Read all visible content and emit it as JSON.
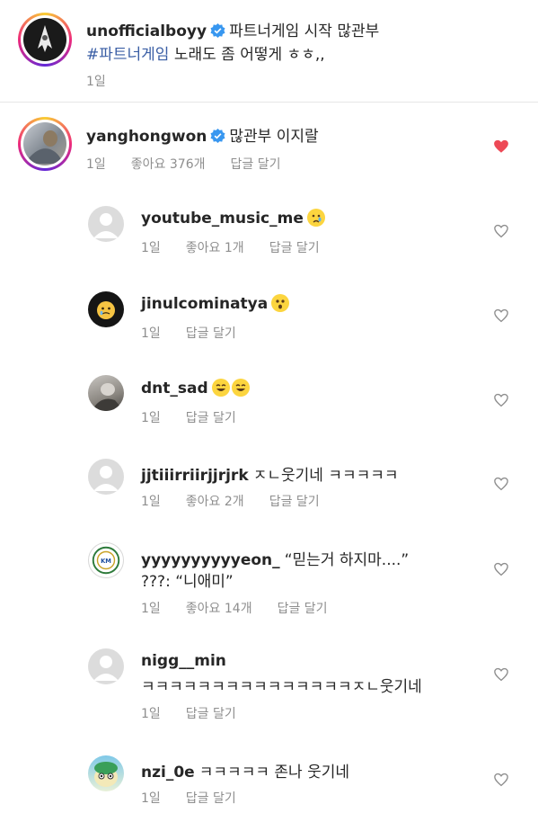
{
  "post": {
    "username": "unofficialboyy",
    "caption_line1": "파트너게임 시작 많관부",
    "hashtag": "#파트너게임",
    "caption_line2_rest": " 노래도 좀 어떻게 ㅎㅎ,,",
    "time": "1일"
  },
  "comment": {
    "username": "yanghongwon",
    "text": "많관부 이지랄",
    "time": "1일",
    "likes": "좋아요 376개",
    "reply": "답글 달기"
  },
  "replies": [
    {
      "username": "youtube_music_me",
      "text": "",
      "emoji": "crying-face",
      "time": "1일",
      "likes": "좋아요 1개",
      "reply": "답글 달기"
    },
    {
      "username": "jinulcominatya",
      "text": "",
      "emoji": "astonished-face",
      "time": "1일",
      "likes": "",
      "reply": "답글 달기"
    },
    {
      "username": "dnt_sad",
      "text": "",
      "emoji": "laughing-faces",
      "time": "1일",
      "likes": "",
      "reply": "답글 달기"
    },
    {
      "username": "jjtiiirriirjjrjrk",
      "text": "ㅈㄴ웃기네 ㅋㅋㅋㅋㅋ",
      "time": "1일",
      "likes": "좋아요 2개",
      "reply": "답글 달기"
    },
    {
      "username": "yyyyyyyyyyeon_",
      "text": "“믿는거 하지마....”",
      "text2": "???: “니애미”",
      "time": "1일",
      "likes": "좋아요 14개",
      "reply": "답글 달기"
    },
    {
      "username": "nigg__min",
      "text": "",
      "text2": "ㅋㅋㅋㅋㅋㅋㅋㅋㅋㅋㅋㅋㅋㅋㅋㅈㄴ웃기네",
      "time": "1일",
      "likes": "",
      "reply": "답글 달기"
    },
    {
      "username": "nzi_0e",
      "text": "ㅋㅋㅋㅋㅋ 존나 웃기네",
      "time": "1일",
      "likes": "",
      "reply": "답글 달기"
    }
  ],
  "colors": {
    "verified": "#3897f0",
    "liked": "#ed4956",
    "muted": "#8e8e8e",
    "hashtag": "#3a5ea5"
  }
}
